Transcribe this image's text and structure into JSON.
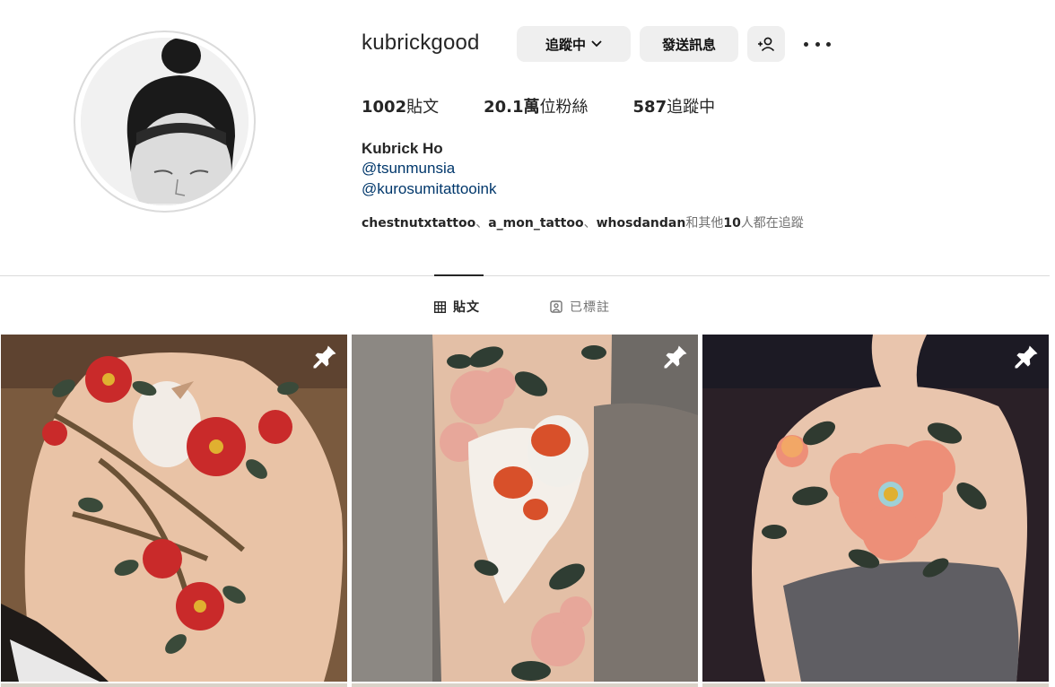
{
  "profile": {
    "username": "kubrickgood",
    "full_name": "Kubrick Ho",
    "links": [
      "@tsunmunsia",
      "@kurosumitattooink"
    ]
  },
  "actions": {
    "following_label": "追蹤中",
    "message_label": "發送訊息"
  },
  "stats": {
    "posts_count": "1002",
    "posts_label": "貼文",
    "followers_count": "20.1萬",
    "followers_label": "位粉絲",
    "following_count": "587",
    "following_label": "追蹤中"
  },
  "followed_by": {
    "users": [
      "chestnutxtattoo",
      "a_mon_tattoo",
      "whosdandan"
    ],
    "separator": "、",
    "suffix_pre": "和其他",
    "others_count": "10",
    "suffix_post": "人都在追蹤"
  },
  "tabs": [
    {
      "label": "貼文",
      "icon": "grid-icon",
      "active": true
    },
    {
      "label": "已標註",
      "icon": "tagged-icon",
      "active": false
    }
  ],
  "posts": [
    {
      "subject": "back tattoo with red camellias and white bird",
      "pinned": true
    },
    {
      "subject": "arm tattoo with goldfish and pink blossoms",
      "pinned": true
    },
    {
      "subject": "shoulder tattoo with coral peony",
      "pinned": true
    }
  ],
  "colors": {
    "link": "#00376b",
    "button_bg": "#efefef",
    "divider": "#dbdbdb",
    "muted": "#737373"
  }
}
